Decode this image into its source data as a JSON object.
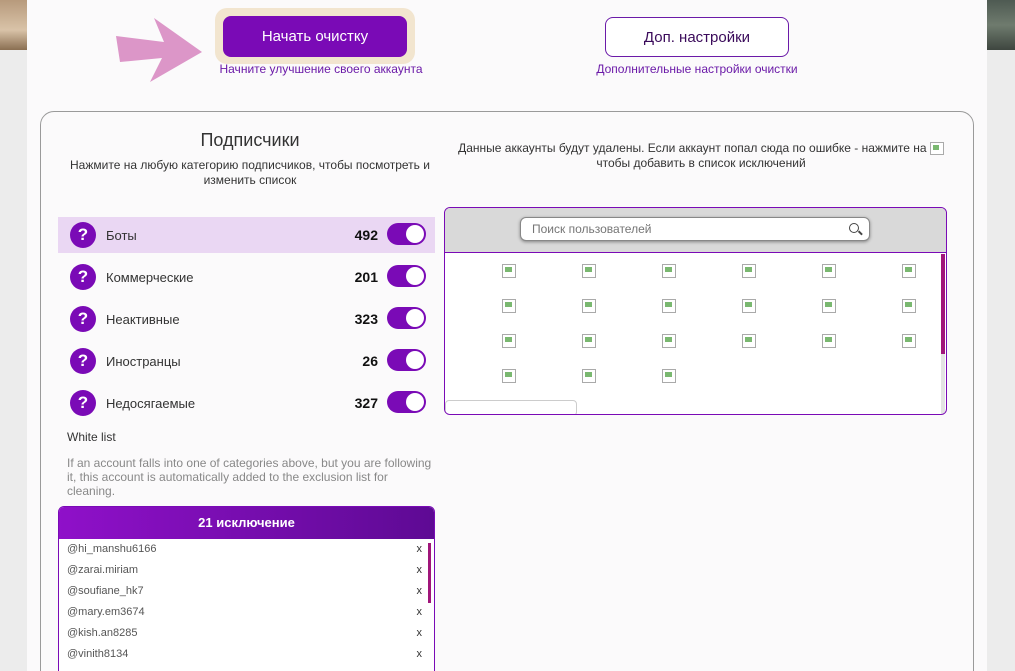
{
  "header": {
    "start_label": "Начать очистку",
    "start_sub": "Начните улучшение своего аккаунта",
    "more_label": "Доп. настройки",
    "more_sub": "Дополнительные настройки очистки"
  },
  "subscribers": {
    "title": "Подписчики",
    "desc": "Нажмите на любую категорию подписчиков, чтобы посмотреть и изменить список",
    "categories": [
      {
        "label": "Боты",
        "count": "492",
        "enabled": true
      },
      {
        "label": "Коммерческие",
        "count": "201",
        "enabled": true
      },
      {
        "label": "Неактивные",
        "count": "323",
        "enabled": true
      },
      {
        "label": "Иностранцы",
        "count": "26",
        "enabled": true
      },
      {
        "label": "Недосягаемые",
        "count": "327",
        "enabled": true
      }
    ]
  },
  "whitelist": {
    "title": "White list",
    "desc": "If an account falls into one of categories above, but you are following it, this account is automatically added to the exclusion list for cleaning.",
    "header": "21 исключение",
    "items": [
      "@hi_manshu6166",
      "@zarai.miriam",
      "@soufiane_hk7",
      "@mary.em3674",
      "@kish.an8285",
      "@vinith8134"
    ],
    "remove_glyph": "x"
  },
  "deletion": {
    "note_before": "Данные аккаунты будут удалены. Если аккаунт попал сюда по ошибке - нажмите на",
    "note_after": "чтобы добавить в список исключений"
  },
  "search": {
    "placeholder": "Поиск пользователей"
  },
  "icons": {
    "help": "question-mark-icon",
    "search": "magnifier-icon",
    "arrow": "pointer-arrow-icon",
    "thumbnail": "broken-image-icon"
  },
  "colors": {
    "accent": "#7a0ab6",
    "active_row": "#ead7f3",
    "arrow": "#dc96c8",
    "scrollbar": "#a0157a"
  },
  "thumbnail_count": 21
}
